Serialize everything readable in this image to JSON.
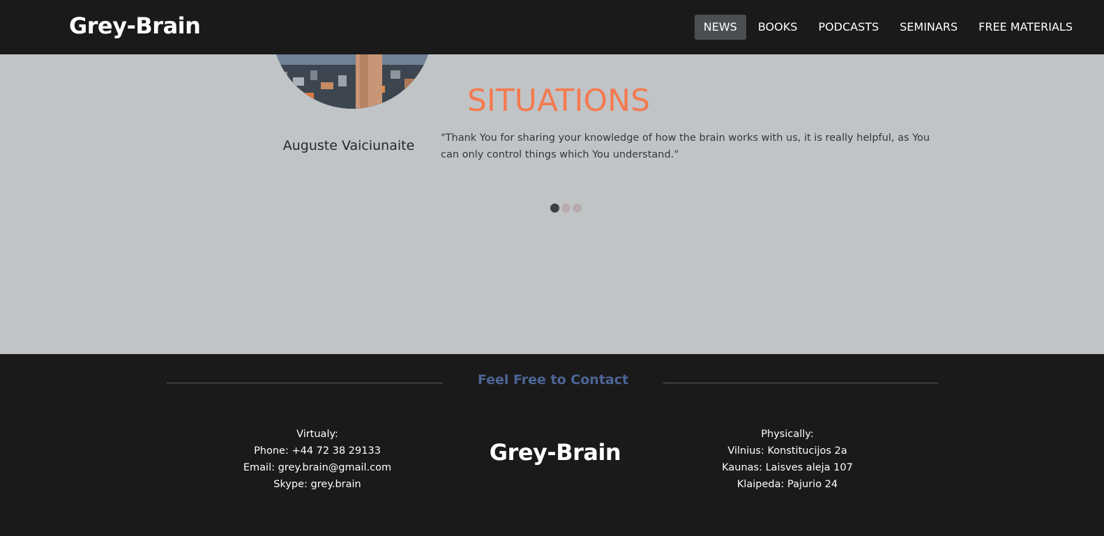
{
  "header": {
    "brand": "Grey-Brain",
    "nav": [
      {
        "label": "NEWS",
        "active": true
      },
      {
        "label": "BOOKS",
        "active": false
      },
      {
        "label": "PODCASTS",
        "active": false
      },
      {
        "label": "SEMINARS",
        "active": false
      },
      {
        "label": "FREE MATERIALS",
        "active": false
      }
    ]
  },
  "testimonial": {
    "headline": "SITUATIONS",
    "name": "Auguste Vaiciunaite",
    "quote": "\"Thank You for sharing your knowledge of how the brain works with us, it is really helpful, as You can only control things which You understand.\"",
    "slide_count": 3,
    "active_slide": 1
  },
  "footer": {
    "heading": "Feel Free to Contact",
    "brand": "Grey-Brain",
    "virtual": {
      "title": "Virtualy:",
      "phone": "Phone: +44 72 38 29133",
      "email": "Email: grey.brain@gmail.com",
      "skype": "Skype: grey.brain"
    },
    "physical": {
      "title": "Physically:",
      "vilnius": "Vilnius: Konstitucijos 2a",
      "kaunas": "Kaunas: Laisves aleja 107",
      "klaipeda": "Klaipeda: Pajurio 24"
    }
  },
  "colors": {
    "navbar_bg": "#1a1a1a",
    "section_bg": "#c0c4c7",
    "accent_orange": "#f47a4f",
    "heading_blue": "#4d6597"
  }
}
